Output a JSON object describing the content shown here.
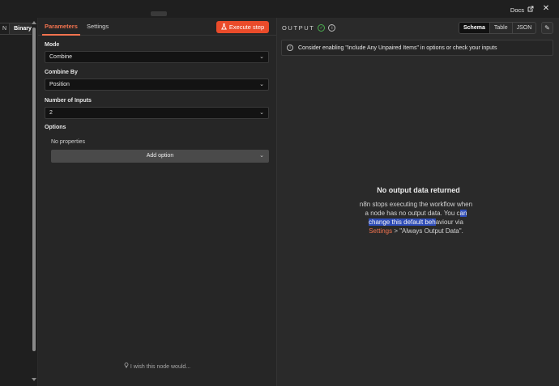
{
  "topbar": {
    "docs_label": "Docs",
    "docs_icon": "external-link-icon",
    "close_icon": "close-icon"
  },
  "input_panel": {
    "view_toggle": [
      "N",
      "Binary"
    ],
    "active_view": "Binary"
  },
  "parameters_panel": {
    "tabs": [
      "Parameters",
      "Settings"
    ],
    "active_tab": "Parameters",
    "execute_label": "Execute step",
    "fields": [
      {
        "label": "Mode",
        "value": "Combine"
      },
      {
        "label": "Combine By",
        "value": "Position"
      },
      {
        "label": "Number of Inputs",
        "value": "2"
      }
    ],
    "options_label": "Options",
    "no_properties": "No properties",
    "add_option_label": "Add option",
    "wish_text": "I wish this node would..."
  },
  "output_panel": {
    "title": "OUTPUT",
    "views": [
      "Schema",
      "Table",
      "JSON"
    ],
    "active_view": "Schema",
    "banner_text": "Consider enabling \"Include Any Unpaired Items\" in options or check your inputs",
    "empty_title": "No output data returned",
    "empty_line1": "n8n stops executing the workflow when a node has no output data. You c",
    "empty_highlight": "an change this default beh",
    "empty_line2": "aviour via ",
    "settings_link": "Settings",
    "empty_line3": " > \"Always Output Data\"."
  },
  "colors": {
    "accent": "#f2734f",
    "execute_button": "#ea4b2a",
    "success": "#4caf50",
    "selection": "#2e4cb8"
  }
}
